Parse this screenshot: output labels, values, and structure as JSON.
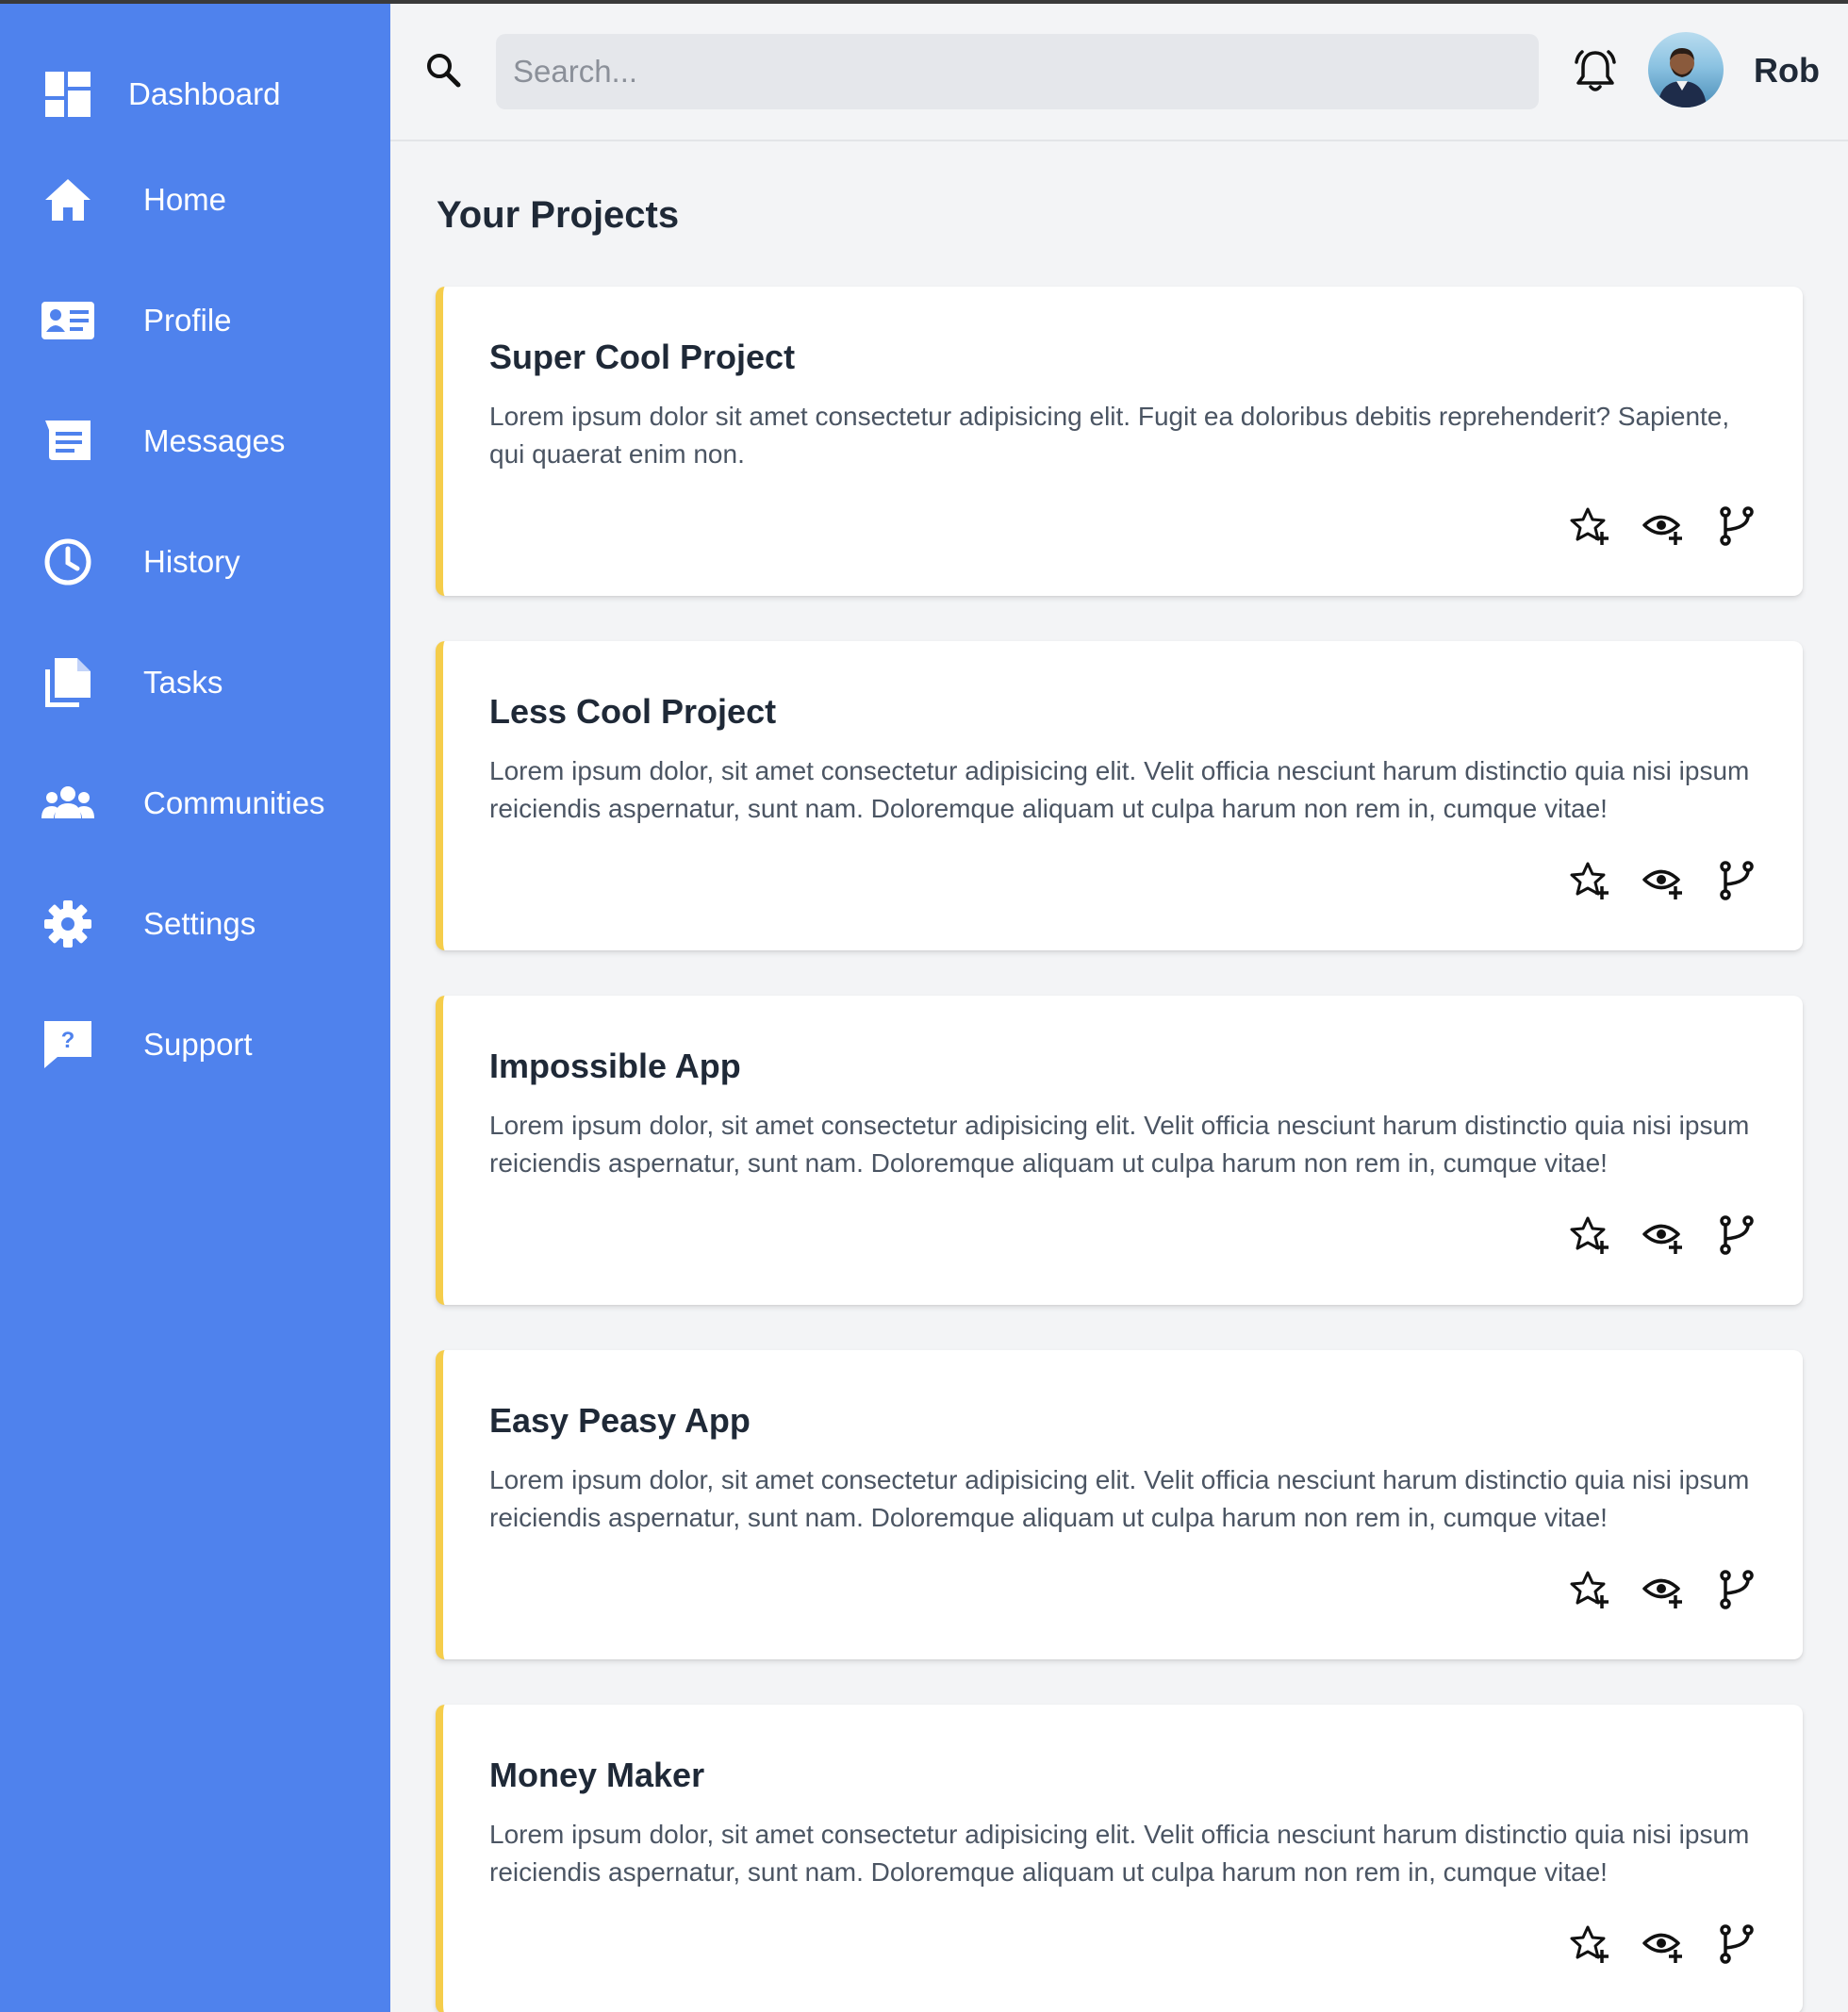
{
  "sidebar": {
    "items": [
      {
        "label": "Dashboard",
        "icon": "dashboard-icon"
      },
      {
        "label": "Home",
        "icon": "home-icon"
      },
      {
        "label": "Profile",
        "icon": "profile-card-icon"
      },
      {
        "label": "Messages",
        "icon": "messages-icon"
      },
      {
        "label": "History",
        "icon": "clock-icon"
      },
      {
        "label": "Tasks",
        "icon": "documents-icon"
      },
      {
        "label": "Communities",
        "icon": "people-icon"
      },
      {
        "label": "Settings",
        "icon": "gear-icon"
      },
      {
        "label": "Support",
        "icon": "help-chat-icon"
      }
    ]
  },
  "header": {
    "search_placeholder": "Search...",
    "search_icon": "search-icon",
    "bell_icon": "bell-icon",
    "username": "Rob"
  },
  "main": {
    "title": "Your Projects",
    "projects": [
      {
        "title": "Super Cool Project",
        "description": "Lorem ipsum dolor sit amet consectetur adipisicing elit. Fugit ea doloribus debitis reprehenderit? Sapiente, qui quaerat enim non."
      },
      {
        "title": "Less Cool Project",
        "description": "Lorem ipsum dolor, sit amet consectetur adipisicing elit. Velit officia nesciunt harum distinctio quia nisi ipsum reiciendis aspernatur, sunt nam. Doloremque aliquam ut culpa harum non rem in, cumque vitae!"
      },
      {
        "title": "Impossible App",
        "description": "Lorem ipsum dolor, sit amet consectetur adipisicing elit. Velit officia nesciunt harum distinctio quia nisi ipsum reiciendis aspernatur, sunt nam. Doloremque aliquam ut culpa harum non rem in, cumque vitae!"
      },
      {
        "title": "Easy Peasy App",
        "description": "Lorem ipsum dolor, sit amet consectetur adipisicing elit. Velit officia nesciunt harum distinctio quia nisi ipsum reiciendis aspernatur, sunt nam. Doloremque aliquam ut culpa harum non rem in, cumque vitae!"
      },
      {
        "title": "Money Maker",
        "description": "Lorem ipsum dolor, sit amet consectetur adipisicing elit. Velit officia nesciunt harum distinctio quia nisi ipsum reiciendis aspernatur, sunt nam. Doloremque aliquam ut culpa harum non rem in, cumque vitae!"
      }
    ],
    "card_actions": [
      "star-plus-icon",
      "watch-eye-icon",
      "fork-icon"
    ]
  },
  "colors": {
    "sidebar_bg": "#4f82ed",
    "card_accent": "#f5cd4b",
    "page_bg": "#f3f4f6",
    "text_dark": "#1f2937",
    "text_body": "#4b5563"
  }
}
